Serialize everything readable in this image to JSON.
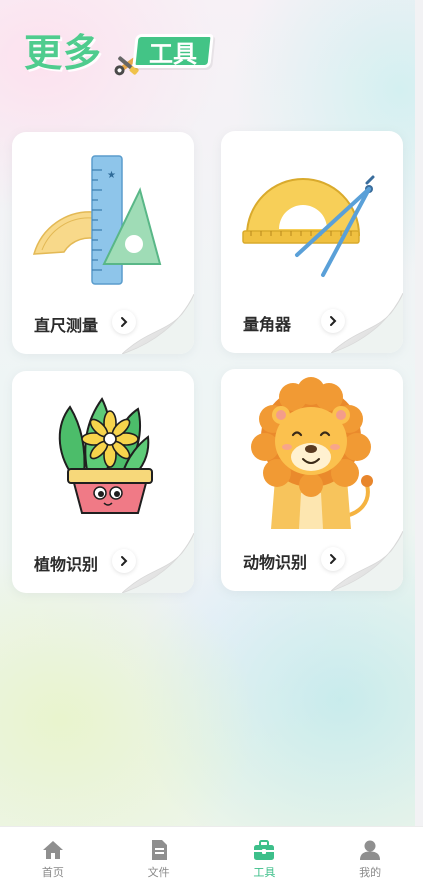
{
  "header": {
    "title": "更多",
    "badge": "工具"
  },
  "cards": [
    {
      "label": "直尺测量"
    },
    {
      "label": "量角器"
    },
    {
      "label": "植物识别"
    },
    {
      "label": "动物识别"
    }
  ],
  "bottom_nav": {
    "items": [
      {
        "label": "首页",
        "icon": "home-icon"
      },
      {
        "label": "文件",
        "icon": "file-icon"
      },
      {
        "label": "工具",
        "icon": "toolbox-icon"
      },
      {
        "label": "我的",
        "icon": "user-icon"
      }
    ],
    "active": "工具"
  },
  "colors": {
    "accent": "#43c486",
    "nav_active": "#3dbf8a",
    "nav_inactive": "#8a8a8a"
  }
}
